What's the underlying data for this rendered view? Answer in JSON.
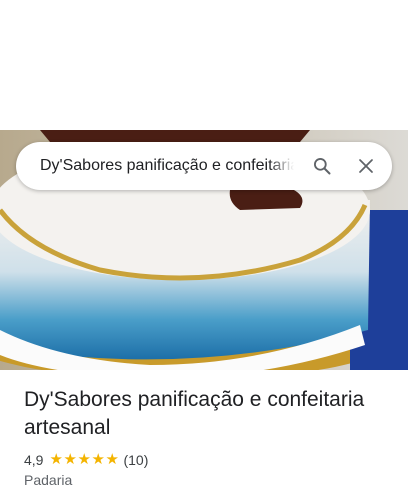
{
  "search": {
    "query": "Dy'Sabores panificação e confeitaria artesanal",
    "search_icon": "search-icon",
    "close_icon": "close-icon"
  },
  "place": {
    "name": "Dy'Sabores panificação e confeitaria artesanal",
    "rating": "4,9",
    "rating_value": 4.9,
    "stars_max": 5,
    "review_count": "(10)",
    "category": "Padaria"
  },
  "colors": {
    "star": "#f4b400",
    "icon": "#5f6368"
  }
}
